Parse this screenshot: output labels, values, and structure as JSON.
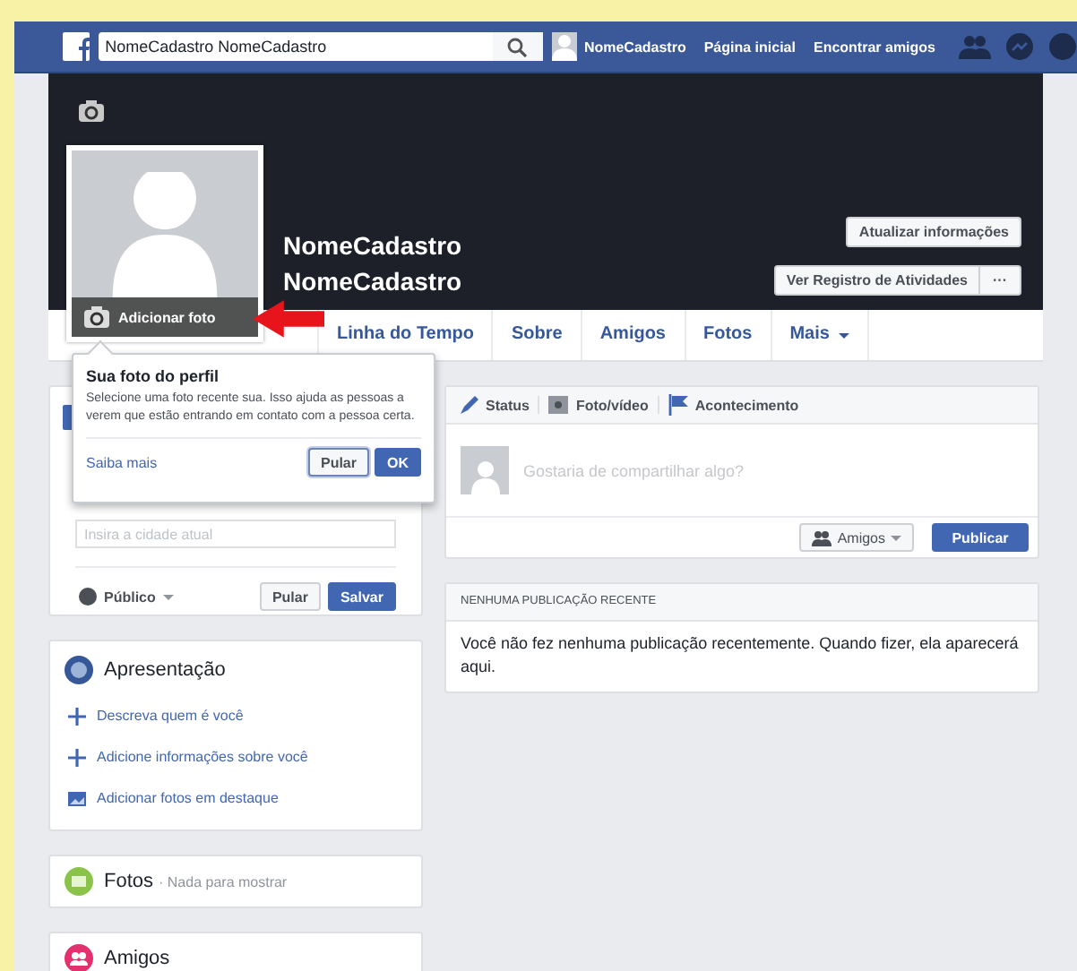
{
  "header": {
    "search_value": "NomeCadastro NomeCadastro",
    "nav": [
      "NomeCadastro",
      "Página inicial",
      "Encontrar amigos"
    ]
  },
  "profile": {
    "name": "NomeCadastro NomeCadastro",
    "photo_action": "Adicionar foto",
    "update_button": "Atualizar informações",
    "activity_button": "Ver Registro de Atividades",
    "more_button": "···"
  },
  "tabs": [
    {
      "label": "Linha do Tempo",
      "dropdown": false
    },
    {
      "label": "Sobre",
      "dropdown": false
    },
    {
      "label": "Amigos",
      "dropdown": false
    },
    {
      "label": "Fotos",
      "dropdown": false
    },
    {
      "label": "Mais",
      "dropdown": true
    }
  ],
  "popup": {
    "title": "Sua foto do perfil",
    "text": "Selecione uma foto recente sua. Isso ajuda as pessoas a verem que estão entrando em contato com a pessoa certa.",
    "link": "Saiba mais",
    "buttons": [
      {
        "label": "Pular",
        "kind": "default"
      },
      {
        "label": "OK",
        "kind": "primary"
      }
    ]
  },
  "city_card": {
    "placeholder": "Insira a cidade atual",
    "privacy": "Público",
    "buttons": [
      {
        "label": "Pular",
        "kind": "default"
      },
      {
        "label": "Salvar",
        "kind": "primary"
      }
    ]
  },
  "intro": {
    "title": "Apresentação",
    "items": [
      {
        "kind": "add",
        "label": "Descreva quem é você"
      },
      {
        "kind": "add",
        "label": "Adicione informações sobre você"
      },
      {
        "kind": "photos",
        "label": "Adicionar fotos em destaque"
      }
    ]
  },
  "photos": {
    "title": "Fotos",
    "note": "· Nada para mostrar"
  },
  "friends": {
    "title": "Amigos"
  },
  "composer": {
    "actions": [
      {
        "kind": "status",
        "label": "Status"
      },
      {
        "kind": "photo",
        "label": "Foto/vídeo"
      },
      {
        "kind": "event",
        "label": "Acontecimento"
      }
    ],
    "placeholder": "Gostaria de compartilhar algo?",
    "audience": "Amigos",
    "submit": "Publicar"
  },
  "posts": {
    "title": "NENHUMA PUBLICAÇÃO RECENTE",
    "text": "Você não fez nenhuma publicação recentemente. Quando fizer, ela aparecerá aqui."
  }
}
